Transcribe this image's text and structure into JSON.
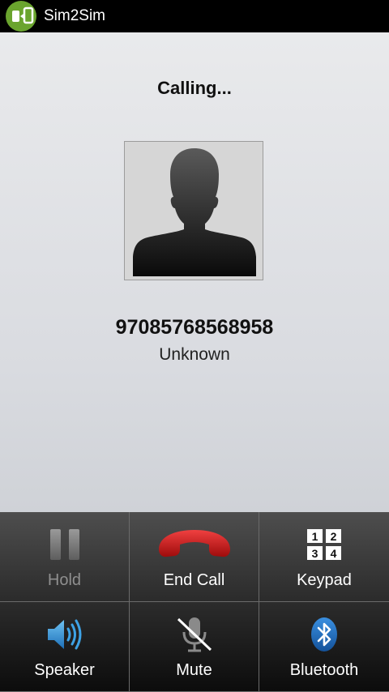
{
  "app": {
    "title": "Sim2Sim"
  },
  "call": {
    "status": "Calling...",
    "number": "97085768568958",
    "label": "Unknown"
  },
  "controls": {
    "hold": {
      "label": "Hold",
      "icon": "pause-icon",
      "enabled": false
    },
    "end_call": {
      "label": "End Call",
      "icon": "phone-hangup-icon",
      "color": "#cc1a1a"
    },
    "keypad": {
      "label": "Keypad",
      "icon": "keypad-icon",
      "keys": [
        "1",
        "2",
        "3",
        "4"
      ]
    },
    "speaker": {
      "label": "Speaker",
      "icon": "speaker-icon",
      "color": "#2b8fd6"
    },
    "mute": {
      "label": "Mute",
      "icon": "mic-off-icon"
    },
    "bluetooth": {
      "label": "Bluetooth",
      "icon": "bluetooth-icon",
      "color": "#2b7fd6"
    }
  }
}
